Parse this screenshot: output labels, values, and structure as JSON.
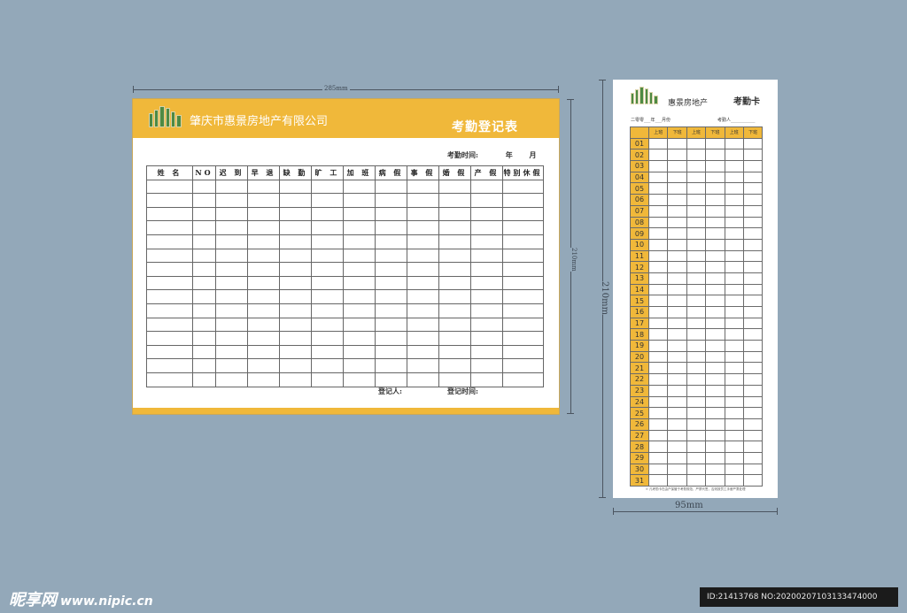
{
  "card1": {
    "dim_width": "285mm",
    "dim_height": "210mm",
    "company": "肇庆市惠景房地产有限公司",
    "title": "考勤登记表",
    "time_label": "考勤时间:",
    "year": "年",
    "month": "月",
    "columns": [
      "姓 名",
      "NO",
      "迟 到",
      "早 退",
      "缺 勤",
      "旷 工",
      "加 班",
      "病 假",
      "事 假",
      "婚 假",
      "产 假",
      "特别休假"
    ],
    "registrar_label": "登记人:",
    "register_time_label": "登记时间:"
  },
  "card2": {
    "dim_width": "95mm",
    "dim_height": "210mm",
    "company": "惠景房地产",
    "title": "考勤卡",
    "period_label": "二零零___年___月份",
    "person_label": "考勤人___________",
    "headers": [
      "上班",
      "下班",
      "上班",
      "下班",
      "上班",
      "下班"
    ],
    "days": [
      "01",
      "02",
      "03",
      "04",
      "05",
      "06",
      "07",
      "08",
      "09",
      "10",
      "11",
      "12",
      "13",
      "14",
      "15",
      "16",
      "17",
      "18",
      "19",
      "20",
      "21",
      "22",
      "23",
      "24",
      "25",
      "26",
      "27",
      "28",
      "29",
      "30",
      "31"
    ],
    "note": "※ 凡考勤卡在由户保管于考勤规范，严禁代签，否则按员工手册严肃处理"
  },
  "watermark": {
    "brand": "昵享网",
    "url": "www.nipic.cn",
    "id_text": "ID:21413768 NO:20200207103133474000"
  },
  "colors": {
    "background": "#93a8b9",
    "accent": "#f0b83a",
    "logo_green": "#4e8a43"
  }
}
